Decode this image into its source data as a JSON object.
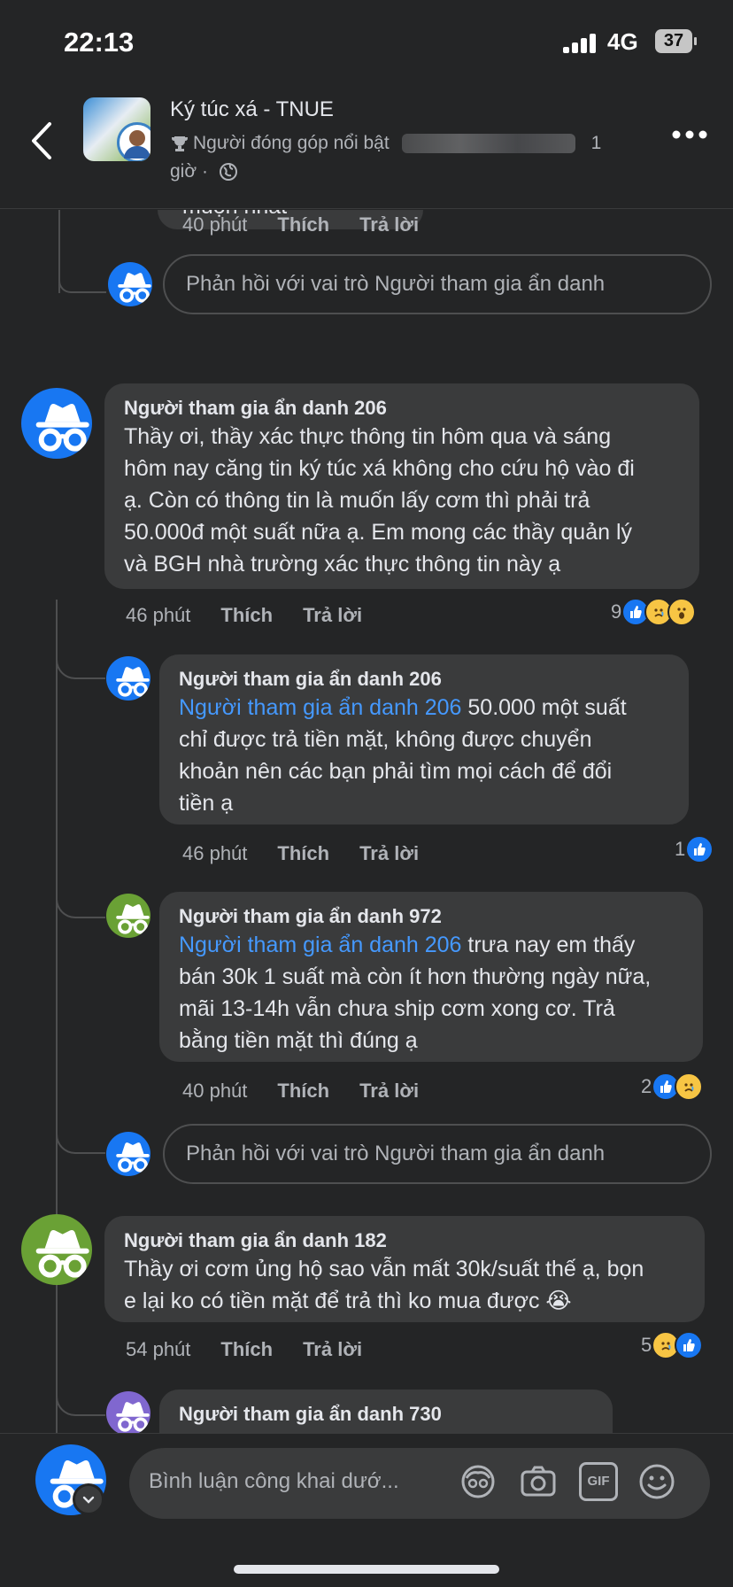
{
  "status": {
    "time": "22:13",
    "network": "4G",
    "battery": "37"
  },
  "header": {
    "group_name": "Ký túc xá - TNUE",
    "badge": "Người đóng góp nổi bật",
    "time_suffix": "1",
    "time_unit": "giờ ·"
  },
  "feed": {
    "top_partial_text": "muộn nhất",
    "top_meta": {
      "time": "40 phút",
      "like": "Thích",
      "reply": "Trả lời"
    },
    "reply_placeholder": "Phản hồi với vai trò Người tham gia ẩn danh",
    "comments": [
      {
        "name": "Người tham gia ẩn danh 206",
        "lines": [
          "Thầy ơi, thầy xác thực thông tin hôm qua và sáng",
          "hôm nay căng tin ký túc xá không cho cứu hộ vào đi",
          "ạ. Còn có thông tin là muốn lấy cơm thì phải trả",
          "50.000đ một suất nữa ạ. Em mong các thầy quản lý",
          "và BGH nhà trường xác thực thông tin này ạ"
        ],
        "time": "46 phút",
        "like": "Thích",
        "reply": "Trả lời",
        "reaction_count": "9"
      },
      {
        "name": "Người tham gia ẩn danh 206",
        "mention": "Người tham gia ẩn danh 206",
        "first_line_rest": " 50.000 một suất",
        "lines": [
          "chỉ được trả tiền mặt, không được chuyển",
          "khoản nên các bạn phải tìm mọi cách để đổi",
          "tiền ạ"
        ],
        "time": "46 phút",
        "like": "Thích",
        "reply": "Trả lời",
        "reaction_count": "1"
      },
      {
        "name": "Người tham gia ẩn danh 972",
        "mention": "Người tham gia ẩn danh 206",
        "first_line_rest": " trưa nay em thấy",
        "lines": [
          "bán 30k 1 suất mà còn ít hơn thường ngày nữa,",
          "mãi 13-14h vẫn chưa ship cơm xong cơ. Trả",
          "bằng tiền mặt thì đúng ạ"
        ],
        "time": "40 phút",
        "like": "Thích",
        "reply": "Trả lời",
        "reaction_count": "2"
      },
      {
        "name": "Người tham gia ẩn danh 182",
        "lines": [
          "Thầy ơi cơm ủng hộ sao vẫn mất 30k/suất thế ạ, bọn",
          "e lại ko có tiền mặt để trả thì ko mua được 😭"
        ],
        "time": "54 phút",
        "like": "Thích",
        "reply": "Trả lời",
        "reaction_count": "5"
      },
      {
        "name": "Người tham gia ẩn danh 730"
      }
    ]
  },
  "composer": {
    "placeholder": "Bình luận công khai dướ...",
    "gif_label": "GIF"
  },
  "colors": {
    "background": "#242526",
    "bubble": "#3a3b3c",
    "link": "#4599ff",
    "like_blue": "#1877f2"
  }
}
